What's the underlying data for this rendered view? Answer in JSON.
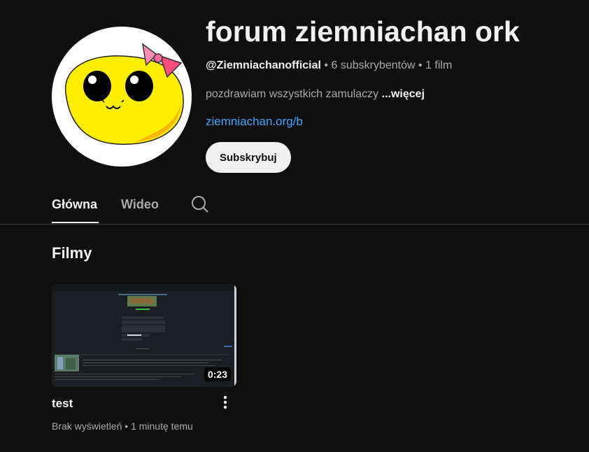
{
  "channel": {
    "title": "forum ziemniachan ork",
    "handle": "@Ziemniachanofficial",
    "separator": "•",
    "subscribers": "6 subskrybentów",
    "video_count": "1 film",
    "description": "pozdrawiam wszystkich zamulaczy",
    "more_label": "...więcej",
    "link": "ziemniachan.org/b",
    "subscribe_label": "Subskrybuj"
  },
  "tabs": [
    {
      "label": "Główna",
      "active": true
    },
    {
      "label": "Wideo",
      "active": false
    }
  ],
  "section": {
    "title": "Filmy"
  },
  "videos": [
    {
      "title": "test",
      "duration": "0:23",
      "views": "Brak wyświetleń",
      "separator": "•",
      "age": "1 minutę temu"
    }
  ],
  "colors": {
    "background": "#0f0f0f",
    "text": "#f1f1f1",
    "secondary_text": "#aaaaaa",
    "link": "#3ea6ff",
    "avatar_yellow": "#ffee00",
    "bow_pink": "#ff6b9d"
  },
  "icons": {
    "search_tab": "search-icon",
    "video_menu": "more-vertical-icon"
  }
}
